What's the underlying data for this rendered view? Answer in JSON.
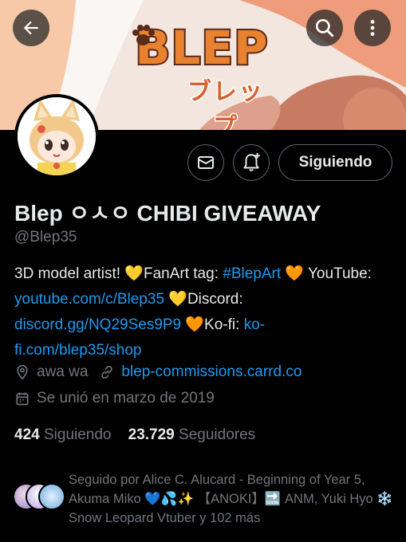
{
  "header": {
    "back_icon": "arrow-left-icon",
    "search_icon": "search-icon",
    "more_icon": "more-vertical-icon",
    "banner_logo": "BLEP",
    "banner_logo_sub": "ブレップ"
  },
  "actions": {
    "message_icon": "mail-icon",
    "notify_icon": "bell-plus-icon",
    "follow_label": "Siguiendo"
  },
  "profile": {
    "name": "Blep ㅇㅅㅇ CHIBI GIVEAWAY",
    "handle": "@Blep35"
  },
  "bio": {
    "part1": "3D model artist! 💛FanArt tag: ",
    "hashtag": "#BlepArt",
    "part2": " 🧡 YouTube: ",
    "youtube": "youtube.com/c/Blep35",
    "part3": " 💛Discord: ",
    "discord": "discord.gg/NQ29Ses9P9",
    "part4": " 🧡Ko-fi: ",
    "kofi": "ko-fi.com/blep35/shop"
  },
  "meta": {
    "location": "awa wa",
    "website": "blep-commissions.carrd.co",
    "joined": "Se unió en marzo de 2019"
  },
  "stats": {
    "following_count": "424",
    "following_label": "Siguiendo",
    "followers_count": "23.729",
    "followers_label": "Seguidores"
  },
  "followed_by": {
    "text": "Seguido por Alice C. Alucard - Beginning of Year 5, Akuma Miko 💙💦✨ 【ANOKI】🔜 ANM, Yuki Hyo ❄️ Snow Leopard Vtuber y 102 más"
  },
  "colors": {
    "accent": "#1d9bf0",
    "secondary_text": "#71767b",
    "border": "#536471"
  }
}
